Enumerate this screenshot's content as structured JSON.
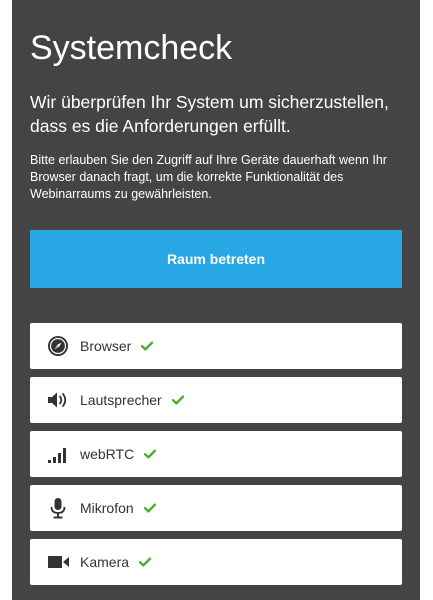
{
  "header": {
    "title": "Systemcheck",
    "lead": "Wir überprüfen Ihr System um sicherzustellen, dass es die Anforderungen erfüllt.",
    "note": "Bitte erlauben Sie den Zugriff auf Ihre Geräte dauerhaft wenn Ihr Browser danach fragt, um die korrekte Funktionalität des Webinarraums zu gewährleisten."
  },
  "actions": {
    "enter_label": "Raum betreten"
  },
  "checks": [
    {
      "label": "Browser",
      "icon": "compass-icon",
      "status": "ok"
    },
    {
      "label": "Lautsprecher",
      "icon": "speaker-icon",
      "status": "ok"
    },
    {
      "label": "webRTC",
      "icon": "signal-bars-icon",
      "status": "ok"
    },
    {
      "label": "Mikrofon",
      "icon": "microphone-icon",
      "status": "ok"
    },
    {
      "label": "Kamera",
      "icon": "video-camera-icon",
      "status": "ok"
    }
  ],
  "colors": {
    "panel": "#444444",
    "accent": "#27a7e3",
    "success": "#4caf2e",
    "icon": "#333333"
  }
}
